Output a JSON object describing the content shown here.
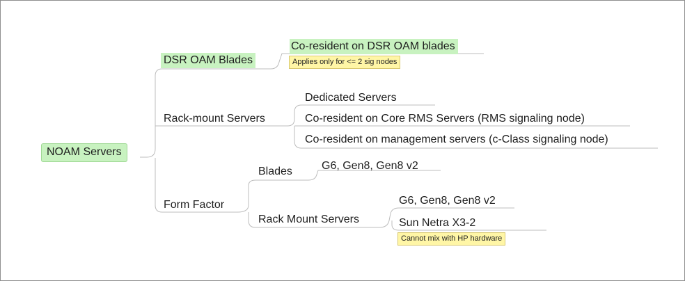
{
  "mindmap": {
    "root": "NOAM Servers",
    "branches": {
      "dsr_oam_blades": {
        "label": "DSR OAM Blades",
        "children": {
          "coresident_oam": "Co-resident on DSR OAM blades"
        },
        "note": "Applies only for <= 2 sig nodes"
      },
      "rack_mount": {
        "label": "Rack-mount Servers",
        "children": {
          "dedicated": "Dedicated Servers",
          "core_rms": "Co-resident on Core RMS Servers (RMS signaling node)",
          "mgmt_servers": "Co-resident on management servers (c-Class signaling node)"
        }
      },
      "form_factor": {
        "label": "Form Factor",
        "children": {
          "blades": {
            "label": "Blades",
            "children": {
              "blade_gens": "G6, Gen8, Gen8 v2"
            }
          },
          "rack_mount_servers": {
            "label": "Rack Mount Servers",
            "children": {
              "rms_gens": "G6, Gen8, Gen8 v2",
              "sun_netra": "Sun Netra X3-2"
            },
            "note": "Cannot mix with HP hardware"
          }
        }
      }
    }
  },
  "colors": {
    "topic_highlight": "#c8f2c0",
    "note_background": "#fff6a6",
    "connector": "#bdbdbd",
    "border": "#8e8e8e"
  }
}
